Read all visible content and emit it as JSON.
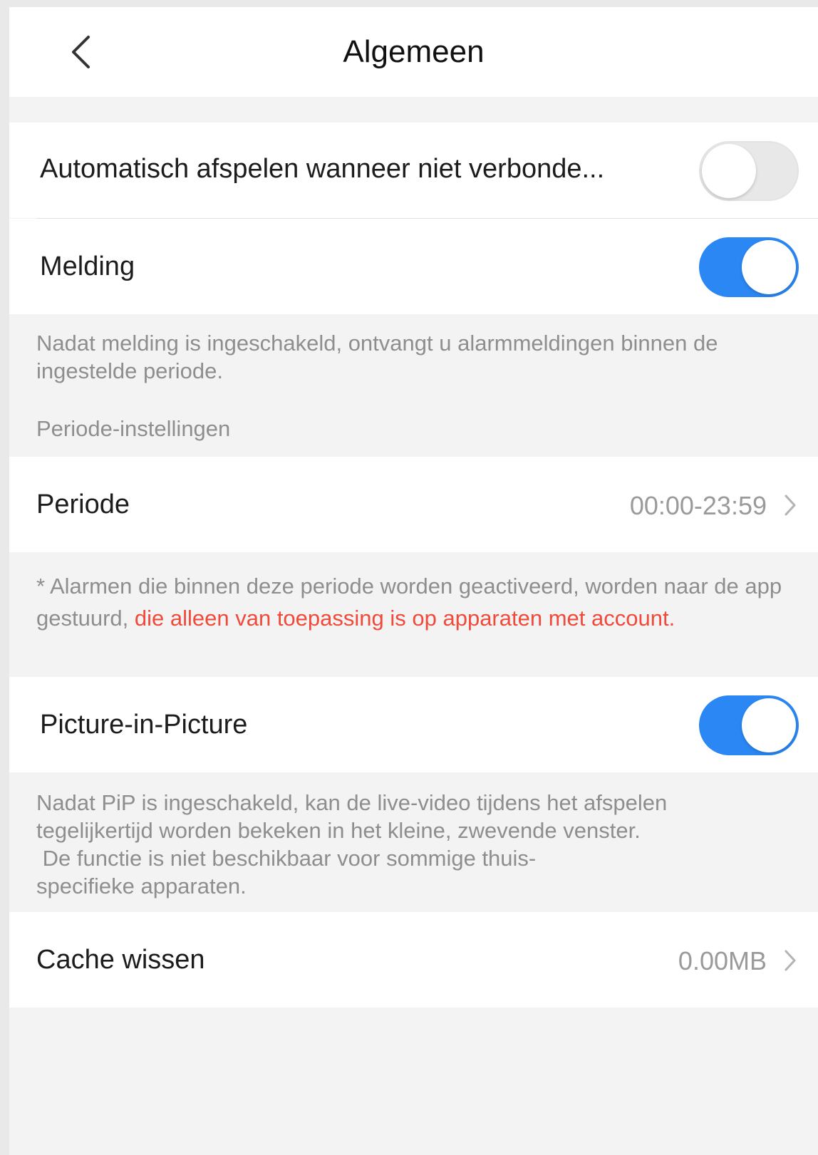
{
  "header": {
    "title": "Algemeen"
  },
  "settings": {
    "autoplay": {
      "label": "Automatisch afspelen wanneer niet verbonde...",
      "enabled": false
    },
    "notification": {
      "label": "Melding",
      "enabled": true,
      "note": "Nadat melding is ingeschakeld, ontvangt u alarmmeldingen binnen de ingestelde periode."
    },
    "period_section": {
      "header": "Periode-instellingen"
    },
    "period": {
      "label": "Periode",
      "value": "00:00-23:59",
      "note_gray": "* Alarmen die binnen deze periode worden geactiveerd, worden naar de app gestuurd,",
      "note_red": "die alleen van toepassing is op apparaten met account."
    },
    "pip": {
      "label": "Picture-in-Picture",
      "enabled": true,
      "note_line1": "Nadat PiP is ingeschakeld, kan de live-video tijdens het afspelen",
      "note_line2": "tegelijkertijd worden bekeken in het kleine, zwevende venster.",
      "note_line3": " De functie is niet beschikbaar voor sommige thuis-",
      "note_line4": "specifieke apparaten."
    },
    "cache": {
      "label": "Cache wissen",
      "value": "0.00MB"
    }
  },
  "colors": {
    "toggle_on": "#2b87f4",
    "toggle_off": "#e8e8e8",
    "warning_text": "#f04a3a",
    "background": "#f3f3f3"
  },
  "icons": {
    "back": "chevron-left-icon",
    "row_arrow": "chevron-right-icon"
  }
}
